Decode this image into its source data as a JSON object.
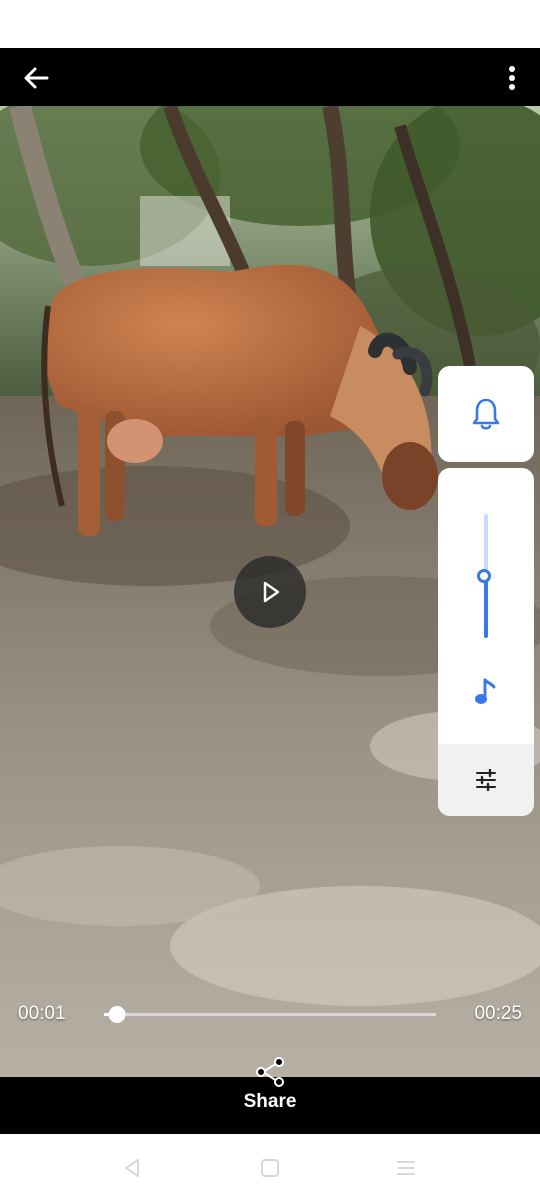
{
  "top_bar": {
    "back_icon": "arrow-left-icon",
    "more_icon": "more-vertical-icon"
  },
  "video": {
    "scene": "brown cow grazing under trees on dry ground"
  },
  "side_panel": {
    "ring_icon": "bell-icon",
    "volume_level": 0.5,
    "music_icon": "music-note-icon",
    "equalizer_icon": "equalizer-icon",
    "accent_color": "#3b78e7"
  },
  "player": {
    "current_time": "00:01",
    "total_time": "00:25",
    "progress": 0.04,
    "play_icon": "play-icon"
  },
  "bottom_bar": {
    "share_label": "Share",
    "share_icon": "share-icon"
  },
  "nav_bar": {
    "back_icon": "nav-back-triangle-icon",
    "home_icon": "nav-home-square-icon",
    "recents_icon": "nav-recents-menu-icon"
  }
}
